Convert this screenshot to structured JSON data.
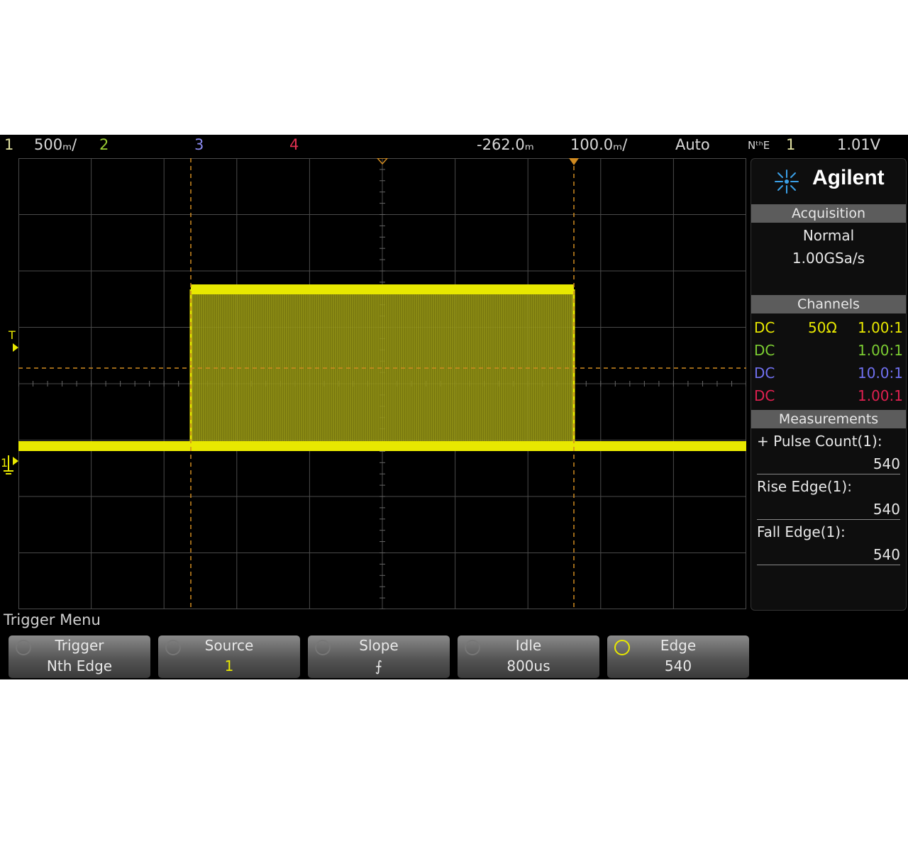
{
  "status_bar": {
    "ch1_label": "1",
    "ch1_scale": "500ₘ/",
    "ch2_label": "2",
    "ch3_label": "3",
    "ch4_label": "4",
    "time_delay": "-262.0ₘ",
    "time_scale": "100.0ₘ/",
    "trigger_mode": "Auto",
    "trigger_type": "NᵗʰE",
    "trigger_source": "1",
    "trigger_level": "1.01V"
  },
  "panel": {
    "brand": "Agilent",
    "acquisition": {
      "title": "Acquisition",
      "mode": "Normal",
      "rate": "1.00GSa/s"
    },
    "channels": {
      "title": "Channels",
      "rows": [
        {
          "coupling": "DC",
          "impedance": "50Ω",
          "probe": "1.00:1",
          "color": "#e8e800"
        },
        {
          "coupling": "DC",
          "impedance": "",
          "probe": "1.00:1",
          "color": "#7ccd32"
        },
        {
          "coupling": "DC",
          "impedance": "",
          "probe": "10.0:1",
          "color": "#7070f0"
        },
        {
          "coupling": "DC",
          "impedance": "",
          "probe": "1.00:1",
          "color": "#e02050"
        }
      ]
    },
    "measurements": {
      "title": "Measurements",
      "items": [
        {
          "label": "+ Pulse Count(1):",
          "value": "540"
        },
        {
          "label": "Rise Edge(1):",
          "value": "540"
        },
        {
          "label": "Fall Edge(1):",
          "value": "540"
        }
      ]
    }
  },
  "softkeys": {
    "menu_title": "Trigger Menu",
    "keys": [
      {
        "label": "Trigger",
        "value": "Nth Edge"
      },
      {
        "label": "Source",
        "value": "1"
      },
      {
        "label": "Slope",
        "value": "⨍"
      },
      {
        "label": "Idle",
        "value": "800us"
      },
      {
        "label": "Edge",
        "value": "540"
      }
    ]
  },
  "colors": {
    "trace": "#e8e800",
    "grid": "#4a4a4a",
    "cursor": "#d08a20"
  }
}
